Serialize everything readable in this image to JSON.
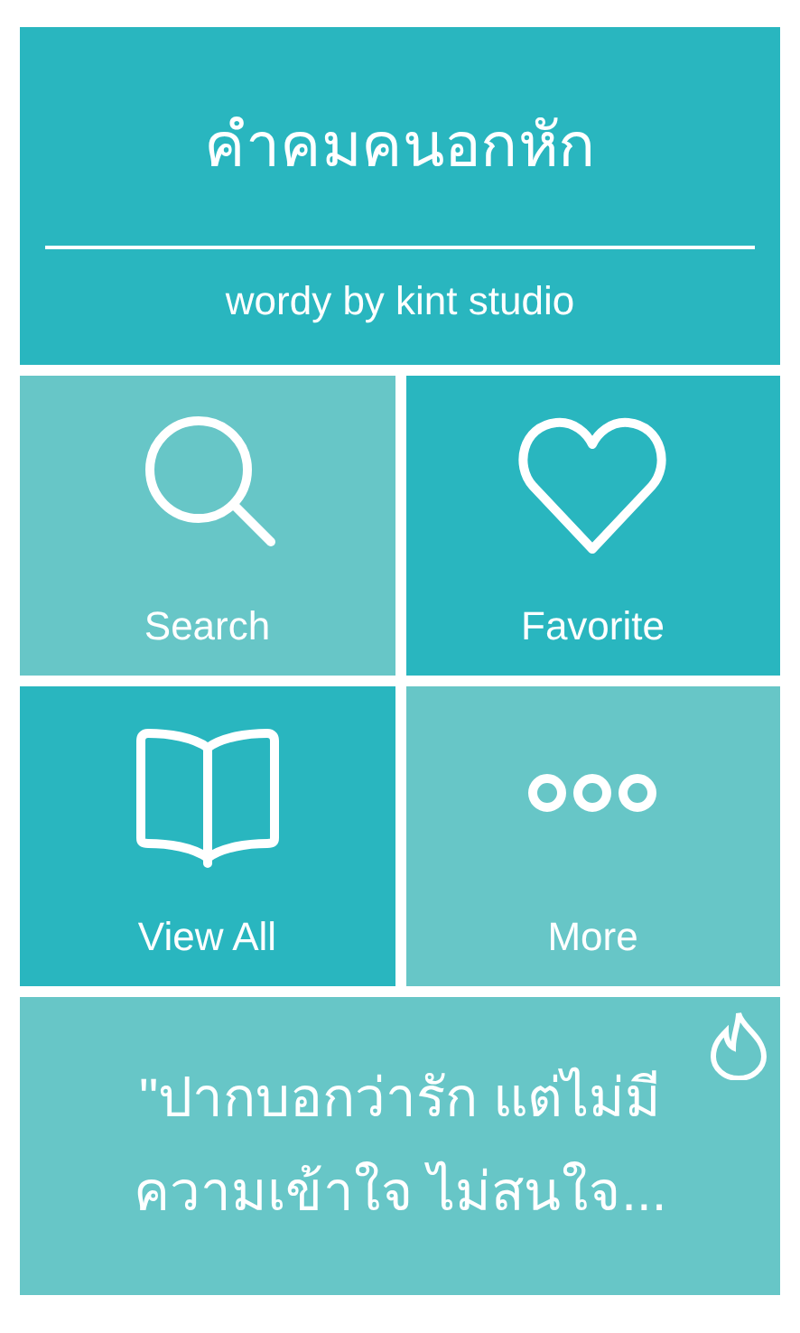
{
  "header": {
    "title": "คำคมคนอกหัก",
    "subtitle": "wordy by kint studio"
  },
  "tiles": [
    {
      "label": "Search",
      "kind": "search",
      "color": "#67c6c7"
    },
    {
      "label": "Favorite",
      "kind": "heart",
      "color": "#29b6bf"
    },
    {
      "label": "View All",
      "kind": "book",
      "color": "#29b6bf"
    },
    {
      "label": "More",
      "kind": "more",
      "color": "#67c6c7"
    }
  ],
  "quote": {
    "text": "\"ปากบอกว่ารัก แต่ไม่มี ความเข้าใจ ไม่สนใจ..."
  }
}
